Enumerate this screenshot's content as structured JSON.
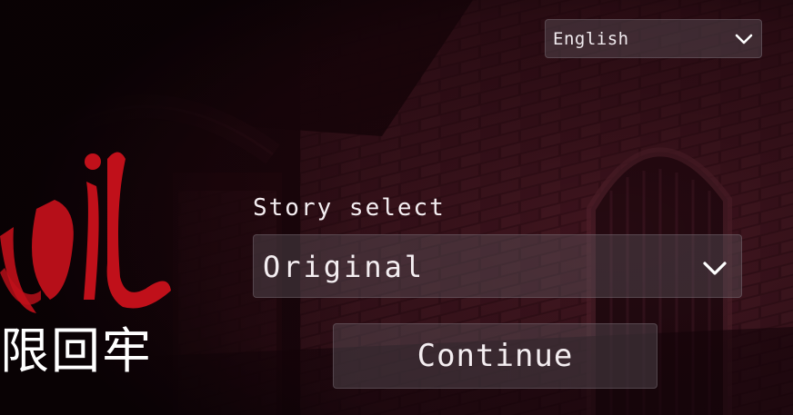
{
  "language_selector": {
    "value": "English",
    "icon": "chevron-down-icon"
  },
  "story_select": {
    "label": "Story select",
    "value": "Original",
    "icon": "chevron-down-icon"
  },
  "continue_button": {
    "label": "Continue"
  },
  "logo": {
    "cjk_title": "限回牢",
    "script_title": "ail"
  },
  "colors": {
    "logo_red": "#c0101a",
    "control_bg": "#5c565c",
    "text": "#f2ecef",
    "background_dark": "#120409",
    "brick": "#4a1a24"
  }
}
